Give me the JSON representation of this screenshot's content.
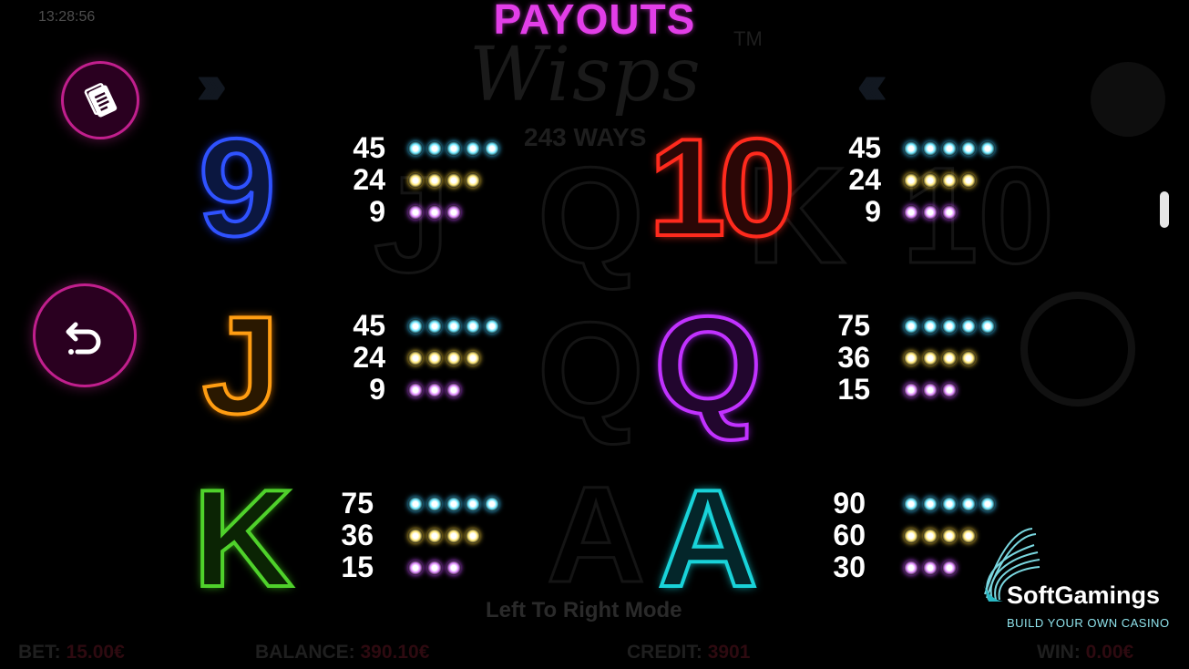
{
  "status": {
    "clock": "13:28:56"
  },
  "header": {
    "title": "PAYOUTS"
  },
  "background": {
    "logo": "Wisps",
    "tm": "TM",
    "ways": "243 WAYS",
    "mode": "Left To Right Mode",
    "bet_label": "BET:",
    "bet_value": "15.00€",
    "balance_label": "BALANCE:",
    "balance_value": "390.10€",
    "credit_label": "CREDIT:",
    "credit_value": "3901",
    "win_label": "WIN:",
    "win_value": "0.00€"
  },
  "paytable": [
    {
      "symbol": "9",
      "color": "#2f52ff",
      "pays": {
        "x5": "45",
        "x4": "24",
        "x3": "9"
      }
    },
    {
      "symbol": "10",
      "color": "#ff2a1d",
      "pays": {
        "x5": "45",
        "x4": "24",
        "x3": "9"
      }
    },
    {
      "symbol": "J",
      "color": "#ff9d12",
      "pays": {
        "x5": "45",
        "x4": "24",
        "x3": "9"
      }
    },
    {
      "symbol": "Q",
      "color": "#c132ff",
      "pays": {
        "x5": "75",
        "x4": "36",
        "x3": "15"
      }
    },
    {
      "symbol": "K",
      "color": "#4fd12b",
      "pays": {
        "x5": "75",
        "x4": "36",
        "x3": "15"
      }
    },
    {
      "symbol": "A",
      "color": "#19d3d9",
      "pays": {
        "x5": "90",
        "x4": "60",
        "x3": "30"
      }
    }
  ],
  "colors": {
    "title": "#e23ee8",
    "button_ring": "#c11f8d",
    "five_match": "#39c8ff",
    "four_match": "#ffd43a",
    "three_match": "#c54bff"
  },
  "icons": {
    "paytable": "document-icon",
    "back": "undo-icon",
    "move": "move-arrows-icon"
  },
  "watermark": {
    "name": "SoftGamings",
    "tagline": "BUILD YOUR OWN CASINO"
  }
}
